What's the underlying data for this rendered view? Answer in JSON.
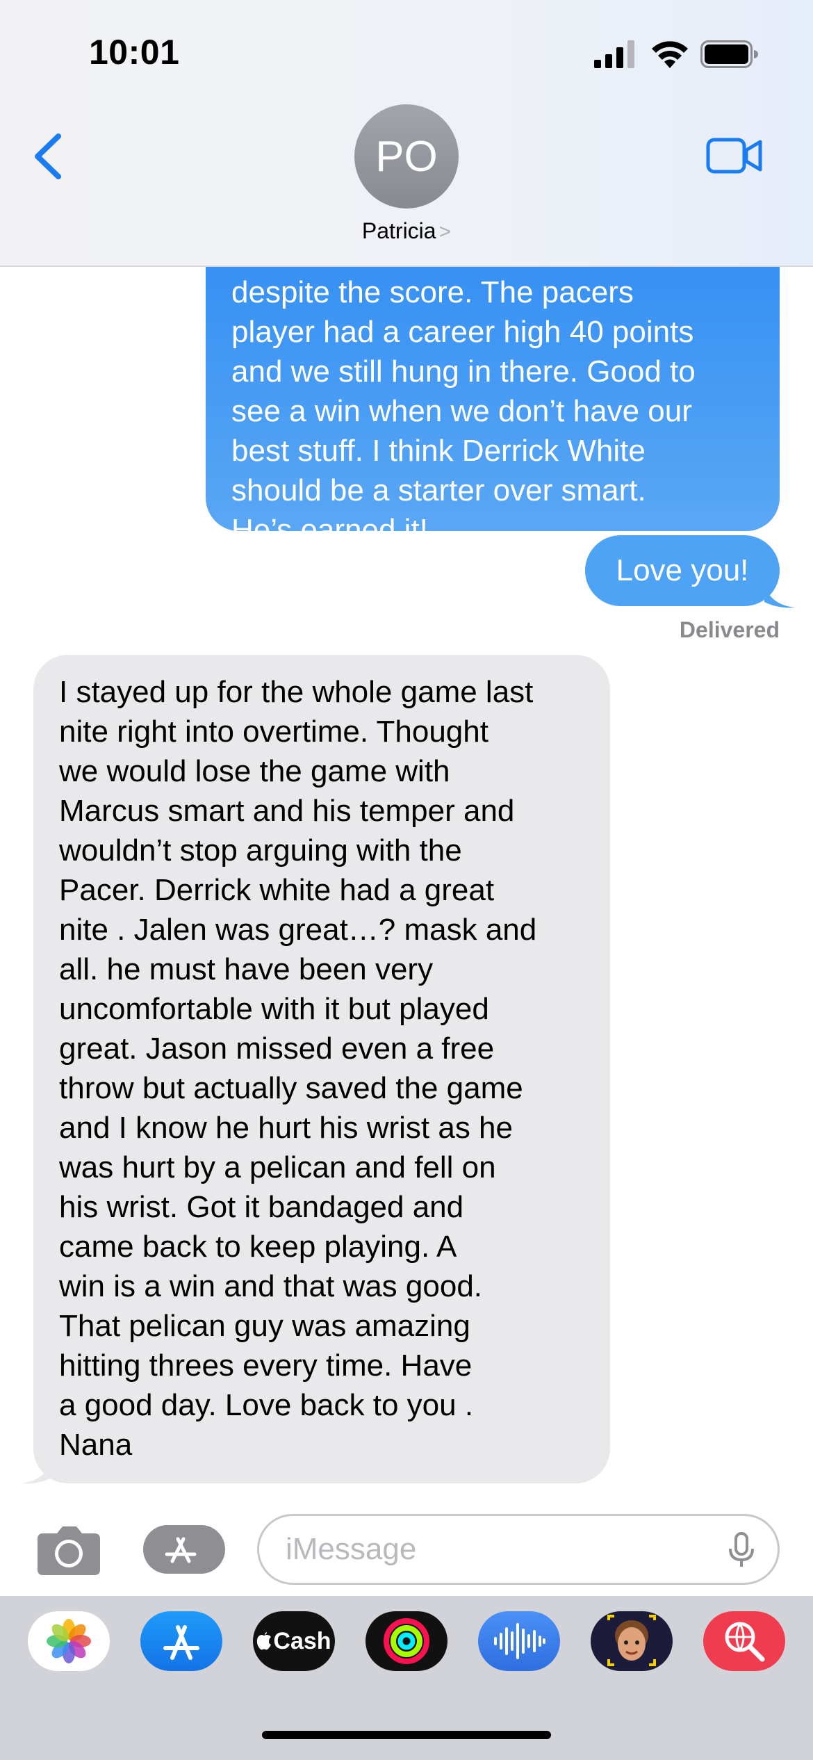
{
  "status_bar": {
    "time": "10:01"
  },
  "header": {
    "avatar_initials": "PO",
    "contact_name": "Patricia",
    "contact_chevron": ">"
  },
  "messages": [
    {
      "direction": "sent",
      "text": "despite the score. The pacers\nplayer had a career high 40 points\nand we still hung in there. Good to\nsee a win when we don’t have our\nbest stuff. I think Derrick White\nshould be a starter over smart.\nHe’s earned it!"
    },
    {
      "direction": "sent",
      "text": "Love you!"
    },
    {
      "direction": "status",
      "text": "Delivered"
    },
    {
      "direction": "received",
      "text": "I stayed up for the whole game last\nnite right into overtime.    Thought\nwe would lose the game with\nMarcus smart and  his temper and\nwouldn’t stop  arguing with the\nPacer.   Derrick white had a great\nnite . Jalen was great…? mask and\nall.   he must have been very\nuncomfortable with it but played\ngreat.   Jason missed even a free\nthrow but actually saved the game\nand I know he hurt his wrist as he\nwas hurt by a pelican and fell on\nhis wrist.   Got it bandaged and\ncame back to keep playing.    A\nwin is a win and that was good.\nThat pelican guy was amazing\nhitting threes  every time.     Have\na good day.  Love back to you .\nNana"
    }
  ],
  "input_bar": {
    "placeholder": "iMessage"
  },
  "dock": {
    "apps": [
      {
        "name": "Photos",
        "icon": "photos-icon"
      },
      {
        "name": "App Store",
        "icon": "app-store-icon"
      },
      {
        "name": "Apple Cash",
        "icon": "apple-cash-icon",
        "label": "Cash"
      },
      {
        "name": "Activity",
        "icon": "activity-rings-icon"
      },
      {
        "name": "Audio Message",
        "icon": "waveform-icon"
      },
      {
        "name": "Memoji",
        "icon": "memoji-icon"
      },
      {
        "name": "Images Search",
        "icon": "globe-search-icon"
      }
    ]
  },
  "colors": {
    "sent_bubble": "#2f8cf3",
    "received_bubble": "#e9e9eb",
    "accent": "#1a7cf0",
    "dock_bg": "#d1d3d9"
  }
}
